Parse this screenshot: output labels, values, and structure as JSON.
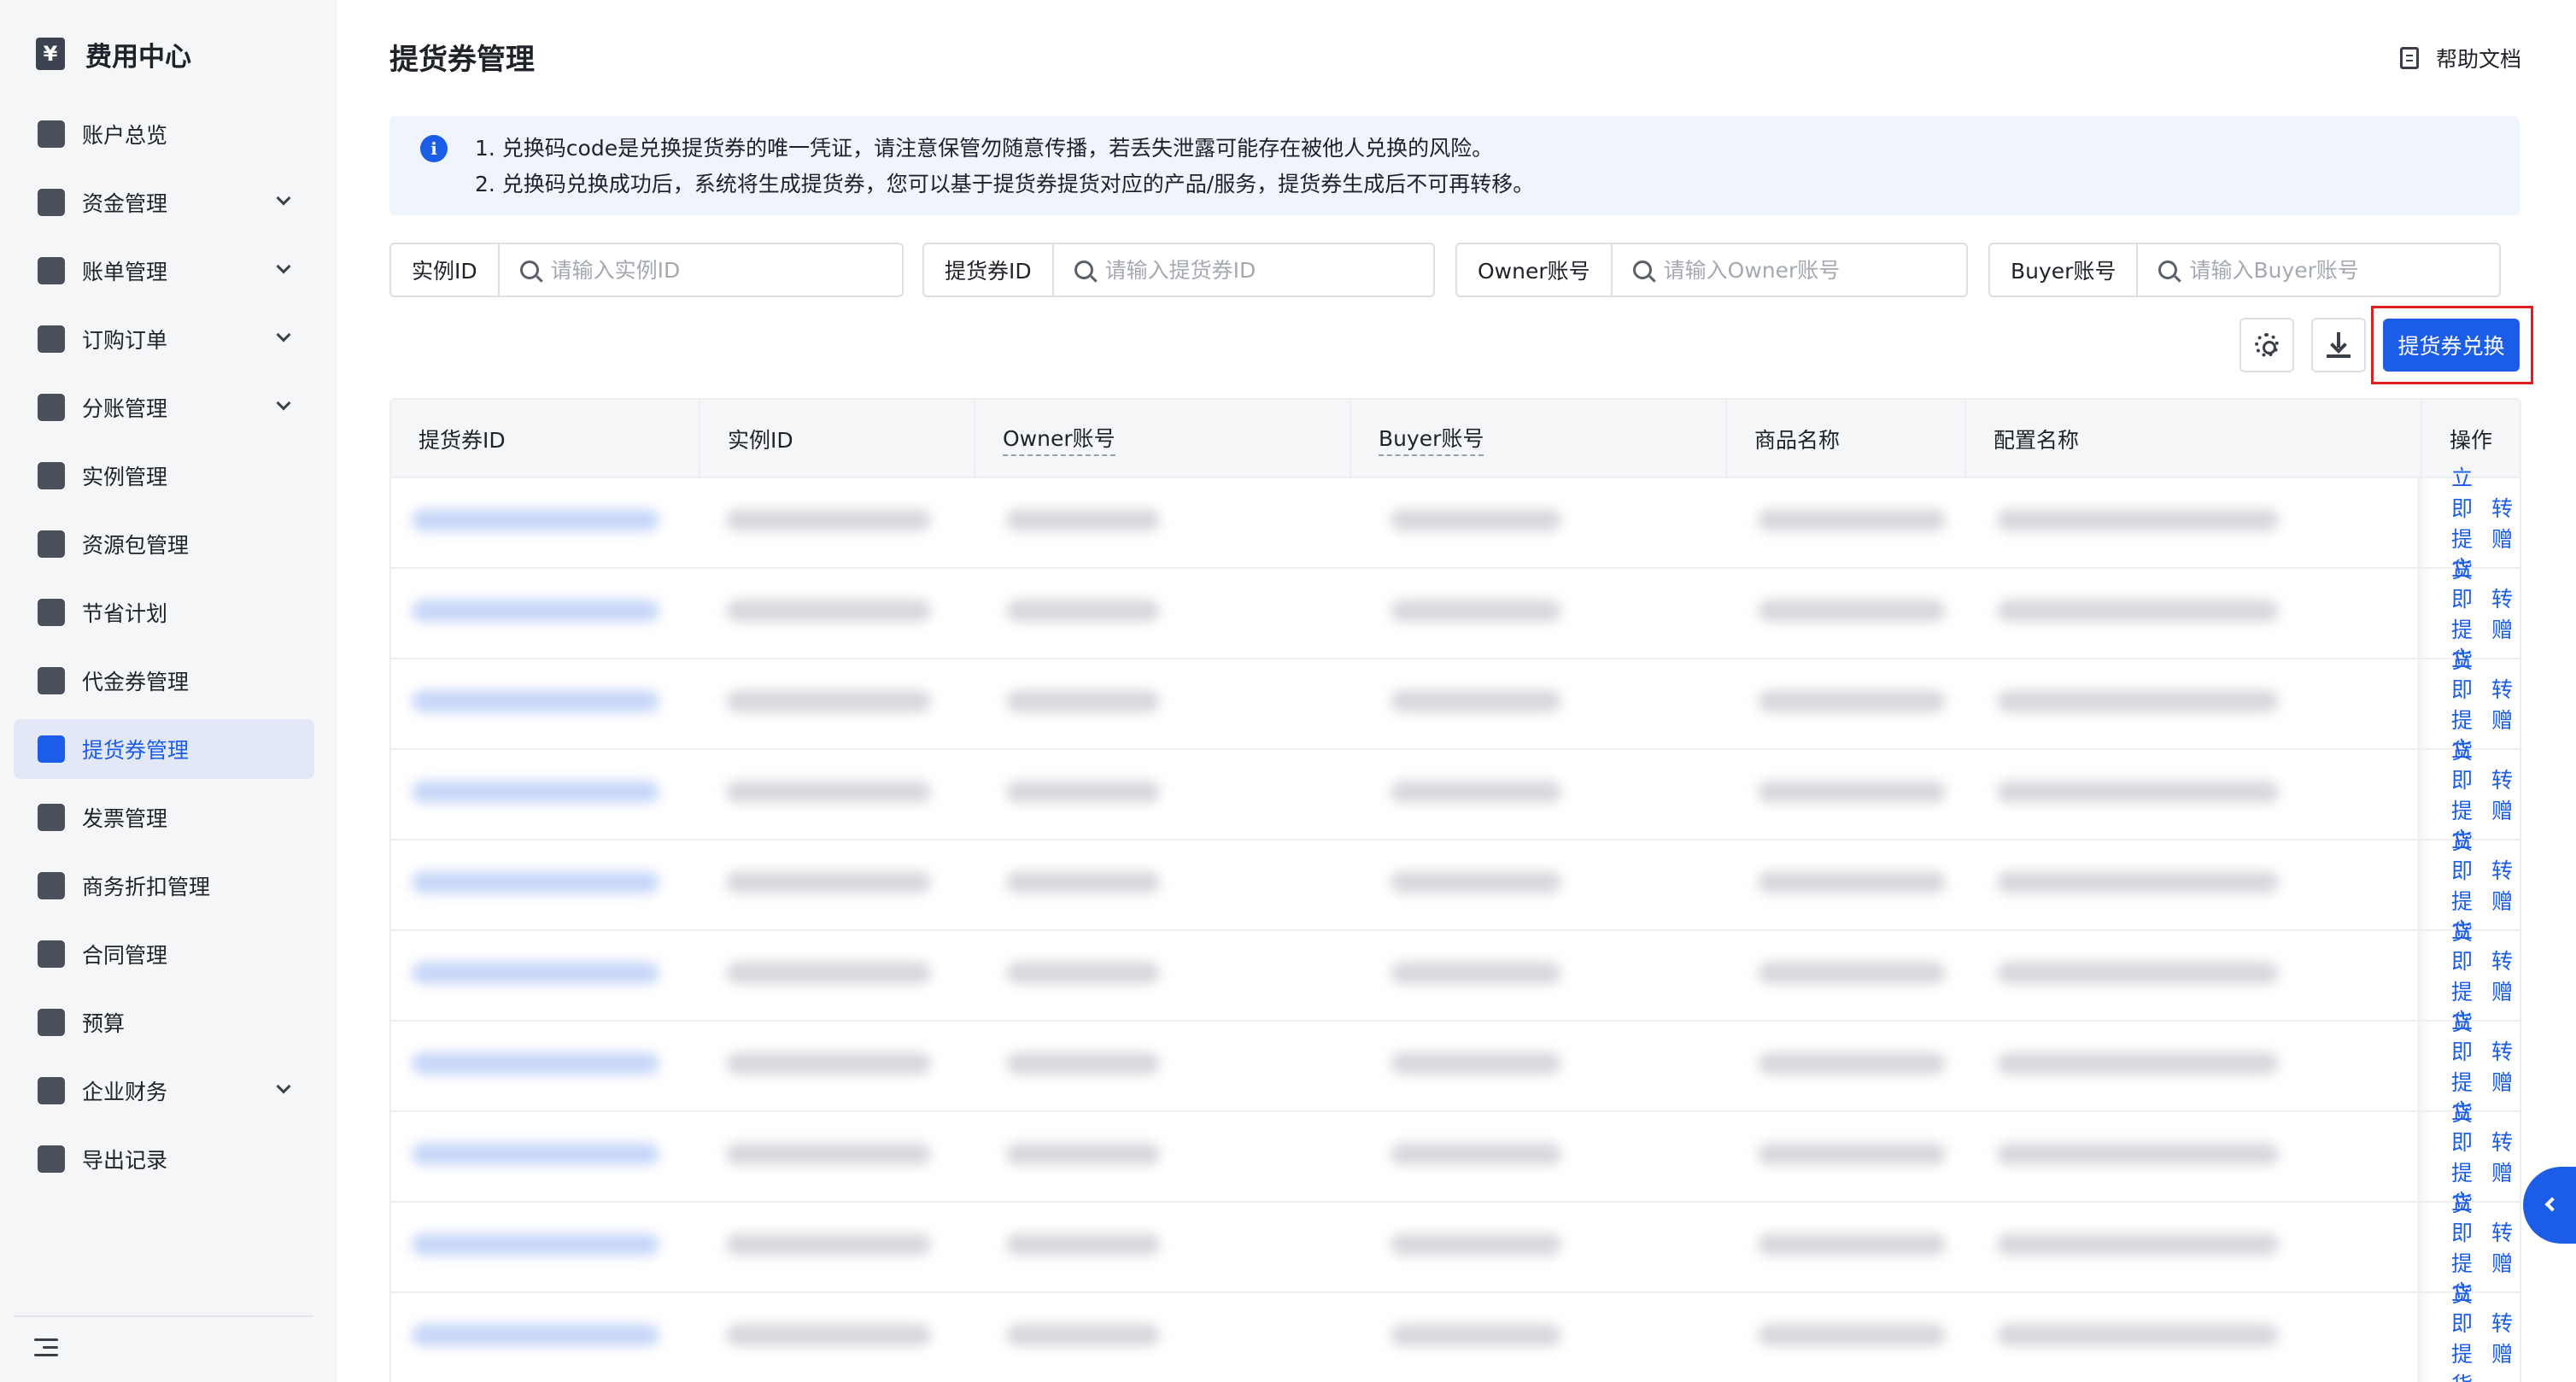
{
  "sidebar": {
    "brand": {
      "icon": "yen-icon",
      "icon_glyph": "¥",
      "title": "费用中心"
    },
    "items": [
      {
        "label": "账户总览",
        "icon": "home-icon",
        "has_submenu": false,
        "active": false
      },
      {
        "label": "资金管理",
        "icon": "yen-icon",
        "has_submenu": true,
        "active": false
      },
      {
        "label": "账单管理",
        "icon": "bill-icon",
        "has_submenu": true,
        "active": false
      },
      {
        "label": "订购订单",
        "icon": "order-icon",
        "has_submenu": true,
        "active": false
      },
      {
        "label": "分账管理",
        "icon": "split-icon",
        "has_submenu": true,
        "active": false
      },
      {
        "label": "实例管理",
        "icon": "cube-icon",
        "has_submenu": false,
        "active": false
      },
      {
        "label": "资源包管理",
        "icon": "package-icon",
        "has_submenu": false,
        "active": false
      },
      {
        "label": "节省计划",
        "icon": "database-icon",
        "has_submenu": false,
        "active": false
      },
      {
        "label": "代金券管理",
        "icon": "coupon-icon",
        "has_submenu": false,
        "active": false
      },
      {
        "label": "提货券管理",
        "icon": "ticket-icon",
        "has_submenu": false,
        "active": true
      },
      {
        "label": "发票管理",
        "icon": "invoice-icon",
        "has_submenu": false,
        "active": false
      },
      {
        "label": "商务折扣管理",
        "icon": "tag-icon",
        "has_submenu": false,
        "active": false
      },
      {
        "label": "合同管理",
        "icon": "contract-icon",
        "has_submenu": false,
        "active": false
      },
      {
        "label": "预算",
        "icon": "chart-icon",
        "has_submenu": false,
        "active": false
      },
      {
        "label": "企业财务",
        "icon": "building-icon",
        "has_submenu": true,
        "active": false
      },
      {
        "label": "导出记录",
        "icon": "export-icon",
        "has_submenu": false,
        "active": false
      }
    ]
  },
  "header": {
    "title": "提货券管理",
    "help_label": "帮助文档"
  },
  "notice": {
    "lines": [
      "1. 兑换码code是兑换提货券的唯一凭证，请注意保管勿随意传播，若丢失泄露可能存在被他人兑换的风险。",
      "2. 兑换码兑换成功后，系统将生成提货券，您可以基于提货券提货对应的产品/服务，提货券生成后不可再转移。"
    ]
  },
  "filters": [
    {
      "label": "实例ID",
      "placeholder": "请输入实例ID"
    },
    {
      "label": "提货券ID",
      "placeholder": "请输入提货券ID"
    },
    {
      "label": "Owner账号",
      "placeholder": "请输入Owner账号"
    },
    {
      "label": "Buyer账号",
      "placeholder": "请输入Buyer账号"
    }
  ],
  "toolbar": {
    "settings_icon": "gear-icon",
    "download_icon": "download-icon",
    "primary_label": "提货券兑换"
  },
  "table": {
    "columns": [
      "提货券ID",
      "实例ID",
      "Owner账号",
      "Buyer账号",
      "商品名称",
      "配置名称",
      "操作"
    ],
    "row_count": 10,
    "row_actions": [
      "立即提货",
      "转赠"
    ]
  },
  "colors": {
    "primary": "#1c5de8",
    "highlight": "#e02020",
    "sidebar_bg": "#f5f6f8",
    "notice_bg": "#eff4fd"
  }
}
